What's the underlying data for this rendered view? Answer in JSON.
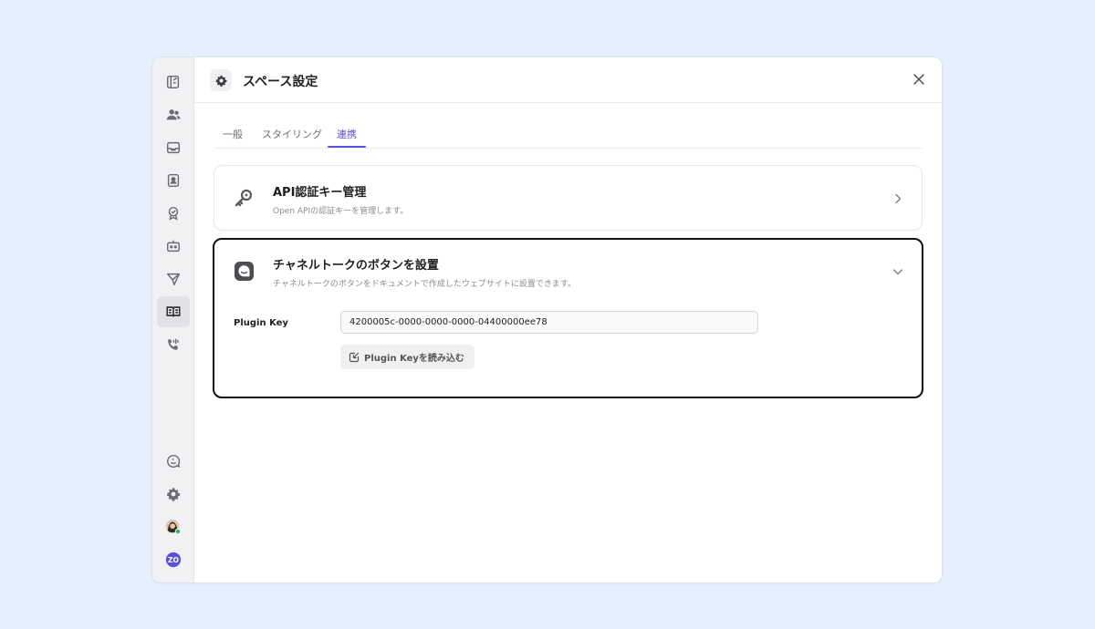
{
  "header": {
    "title": "スペース設定"
  },
  "tabs": [
    {
      "label": "一般"
    },
    {
      "label": "スタイリング"
    },
    {
      "label": "連携"
    }
  ],
  "active_tab": "連携",
  "api_card": {
    "title": "API認証キー管理",
    "description": "Open APIの認証キーを管理します。"
  },
  "channeltalk_card": {
    "title": "チャネルトークのボタンを設置",
    "description": "チャネルトークのボタンをドキュメントで作成したウェブサイトに設置できます。",
    "plugin_key_label": "Plugin Key",
    "plugin_key_value": "4200005c-0000-0000-0000-04400000ee78",
    "load_button_label": "Plugin Keyを読み込む"
  },
  "rail": {
    "avatar_initials": "ZO",
    "accent_color": "#5b50e6",
    "online_color": "#2bb673"
  },
  "icons": [
    "pages-icon",
    "members-icon",
    "inbox-icon",
    "contacts-icon",
    "badge-icon",
    "bot-icon",
    "send-icon",
    "docs-icon",
    "call-icon",
    "chat-smile-icon",
    "gear-icon",
    "user-avatar",
    "workspace-avatar"
  ]
}
